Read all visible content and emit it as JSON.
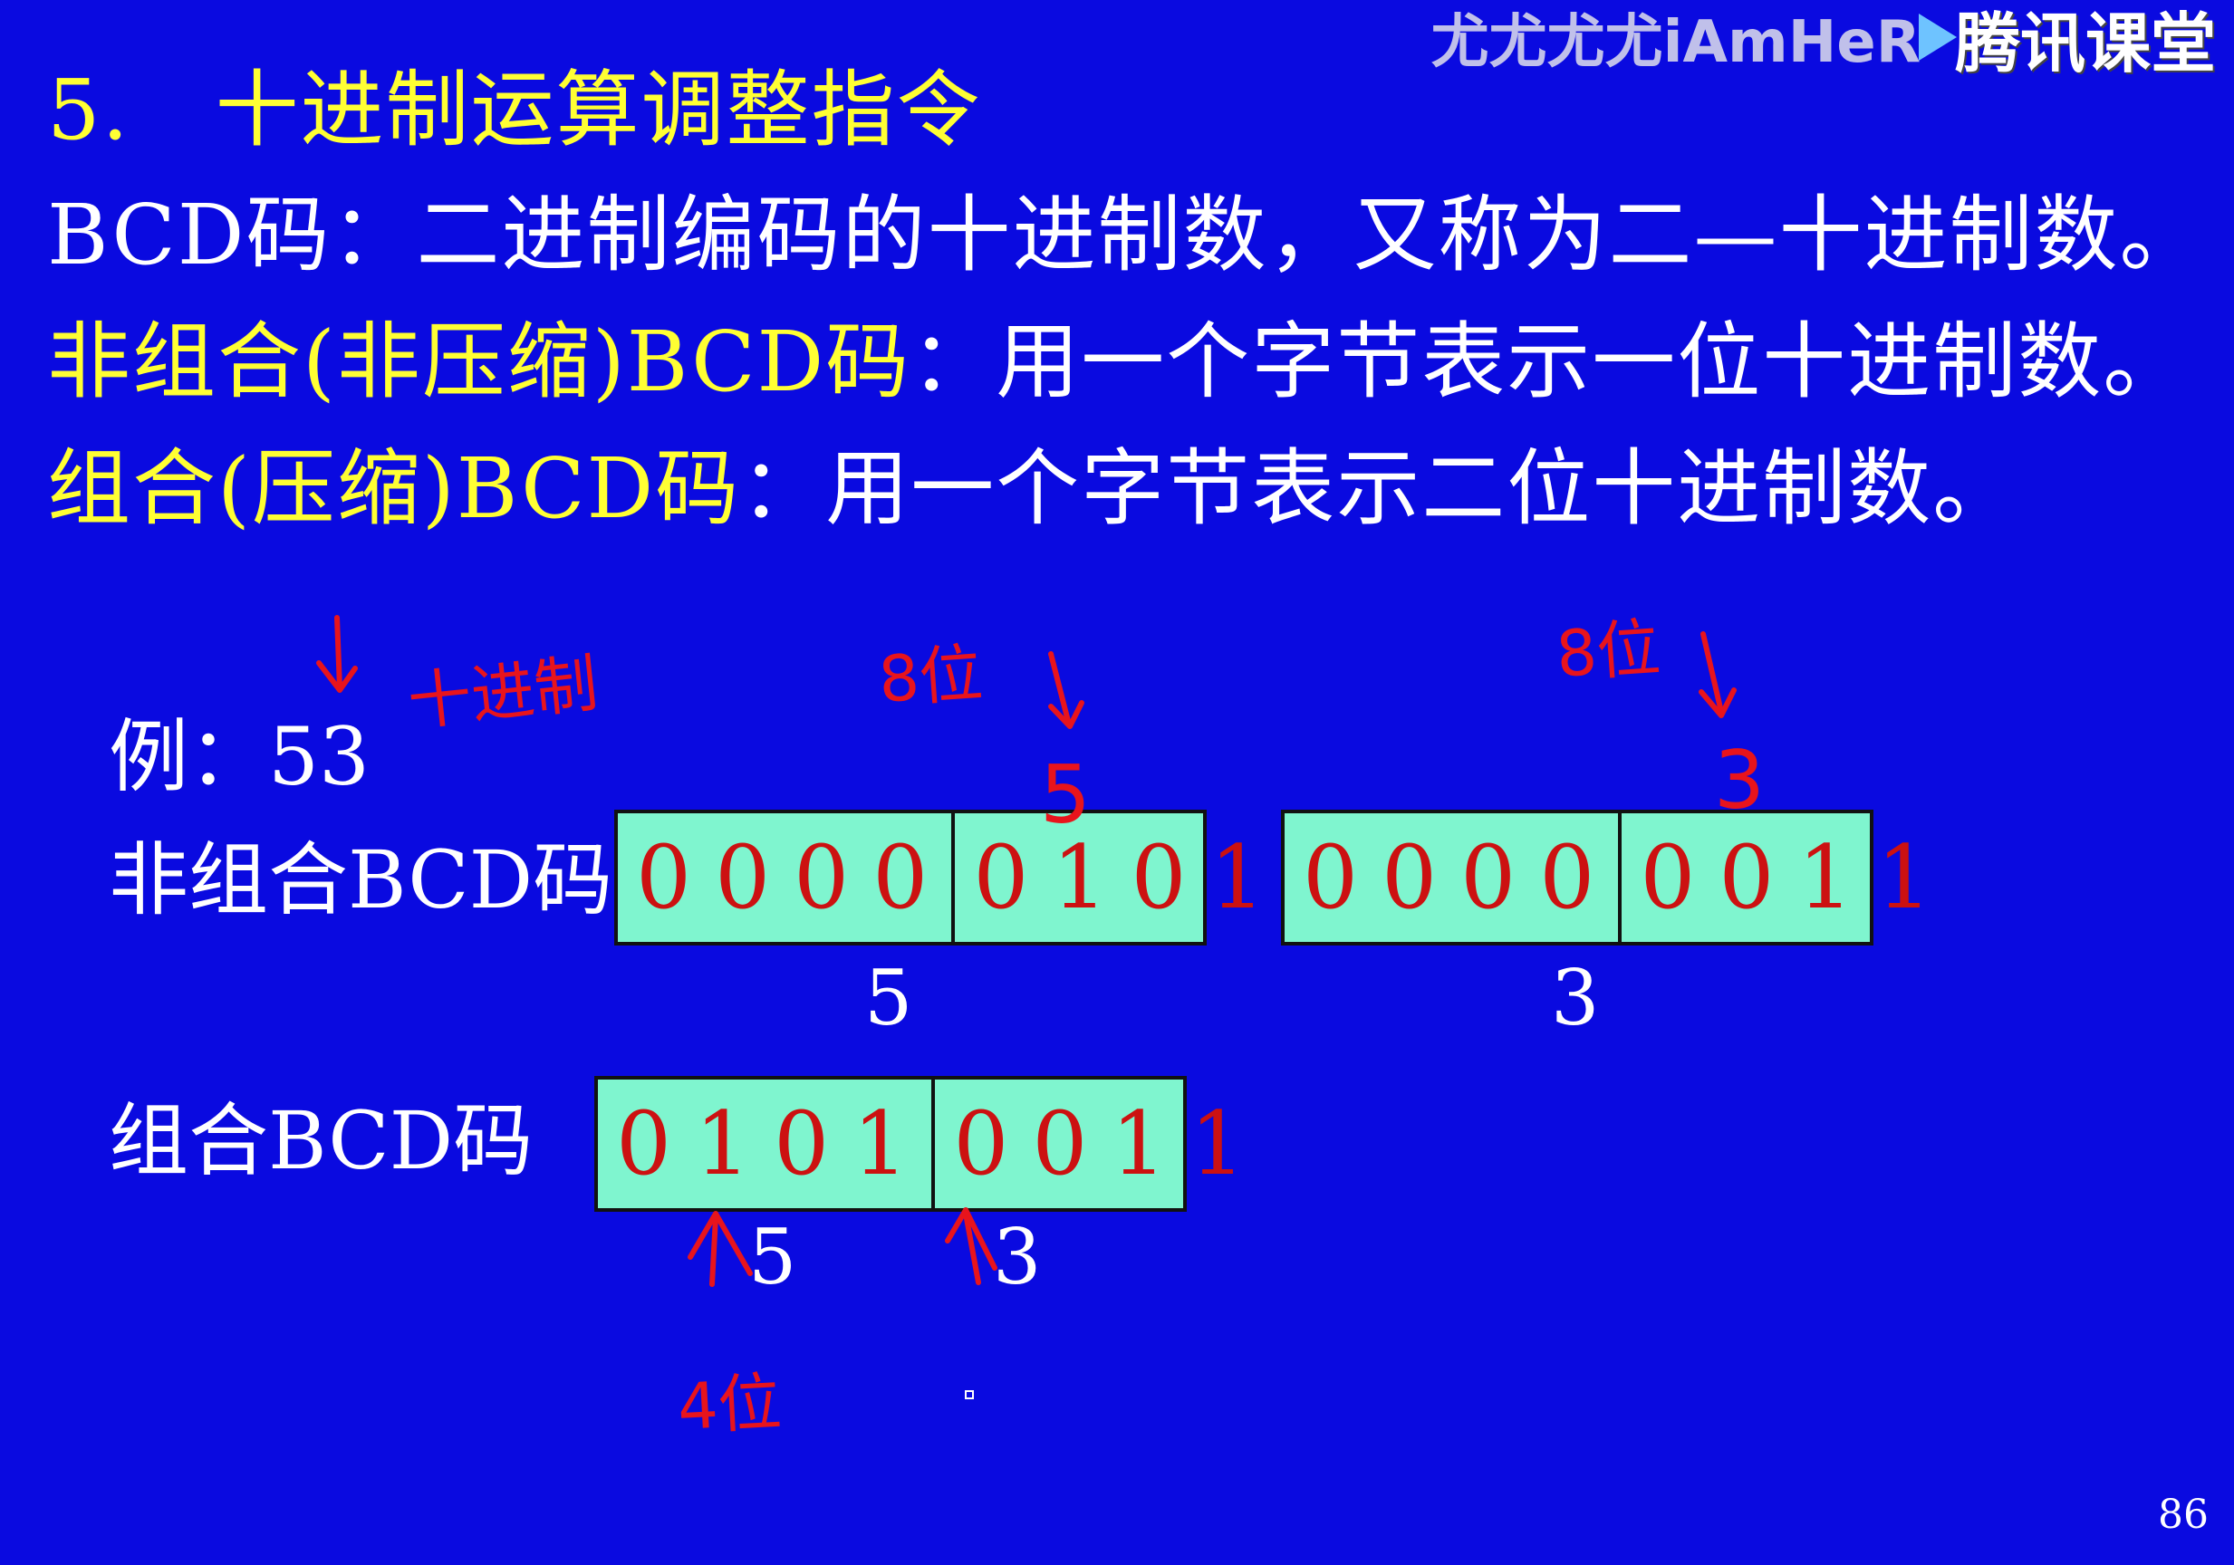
{
  "watermark": {
    "user": "尤尤尤尤iAmHeR",
    "brand": "腾讯课堂"
  },
  "heading": {
    "number": "5.",
    "title": "十进制运算调整指令"
  },
  "definitions": [
    {
      "term": "BCD码",
      "sep": "：",
      "text": "二进制编码的十进制数，又称为二—十进制数。"
    },
    {
      "term": "非组合(非压缩)BCD码",
      "sep": "：",
      "text": "用一个字节表示一位十进制数。"
    },
    {
      "term": "组合(压缩)BCD码",
      "sep": "：",
      "text": "用一个字节表示二位十进制数。"
    }
  ],
  "example": {
    "label": "例：53",
    "unpacked": {
      "label": "非组合BCD码",
      "bytes": [
        {
          "high": "0000",
          "low": "0101",
          "digit": "5"
        },
        {
          "high": "0000",
          "low": "0011",
          "digit": "3"
        }
      ]
    },
    "packed": {
      "label": "组合BCD码",
      "high": "0101",
      "low": "0011",
      "digits": [
        "5",
        "3"
      ]
    }
  },
  "handwritten": {
    "decimal": "十进制",
    "eight_bits_a": "8位",
    "eight_bits_b": "8位",
    "digit_5": "5",
    "digit_3": "3",
    "four_bits": "4位"
  },
  "page_number": "86",
  "colors": {
    "background": "#0a0ae0",
    "highlight_text": "#ffff33",
    "body_text": "#ffffff",
    "cell_fill": "#7ff5cf",
    "bit_text": "#cc1111",
    "annotation": "#e8141c"
  }
}
